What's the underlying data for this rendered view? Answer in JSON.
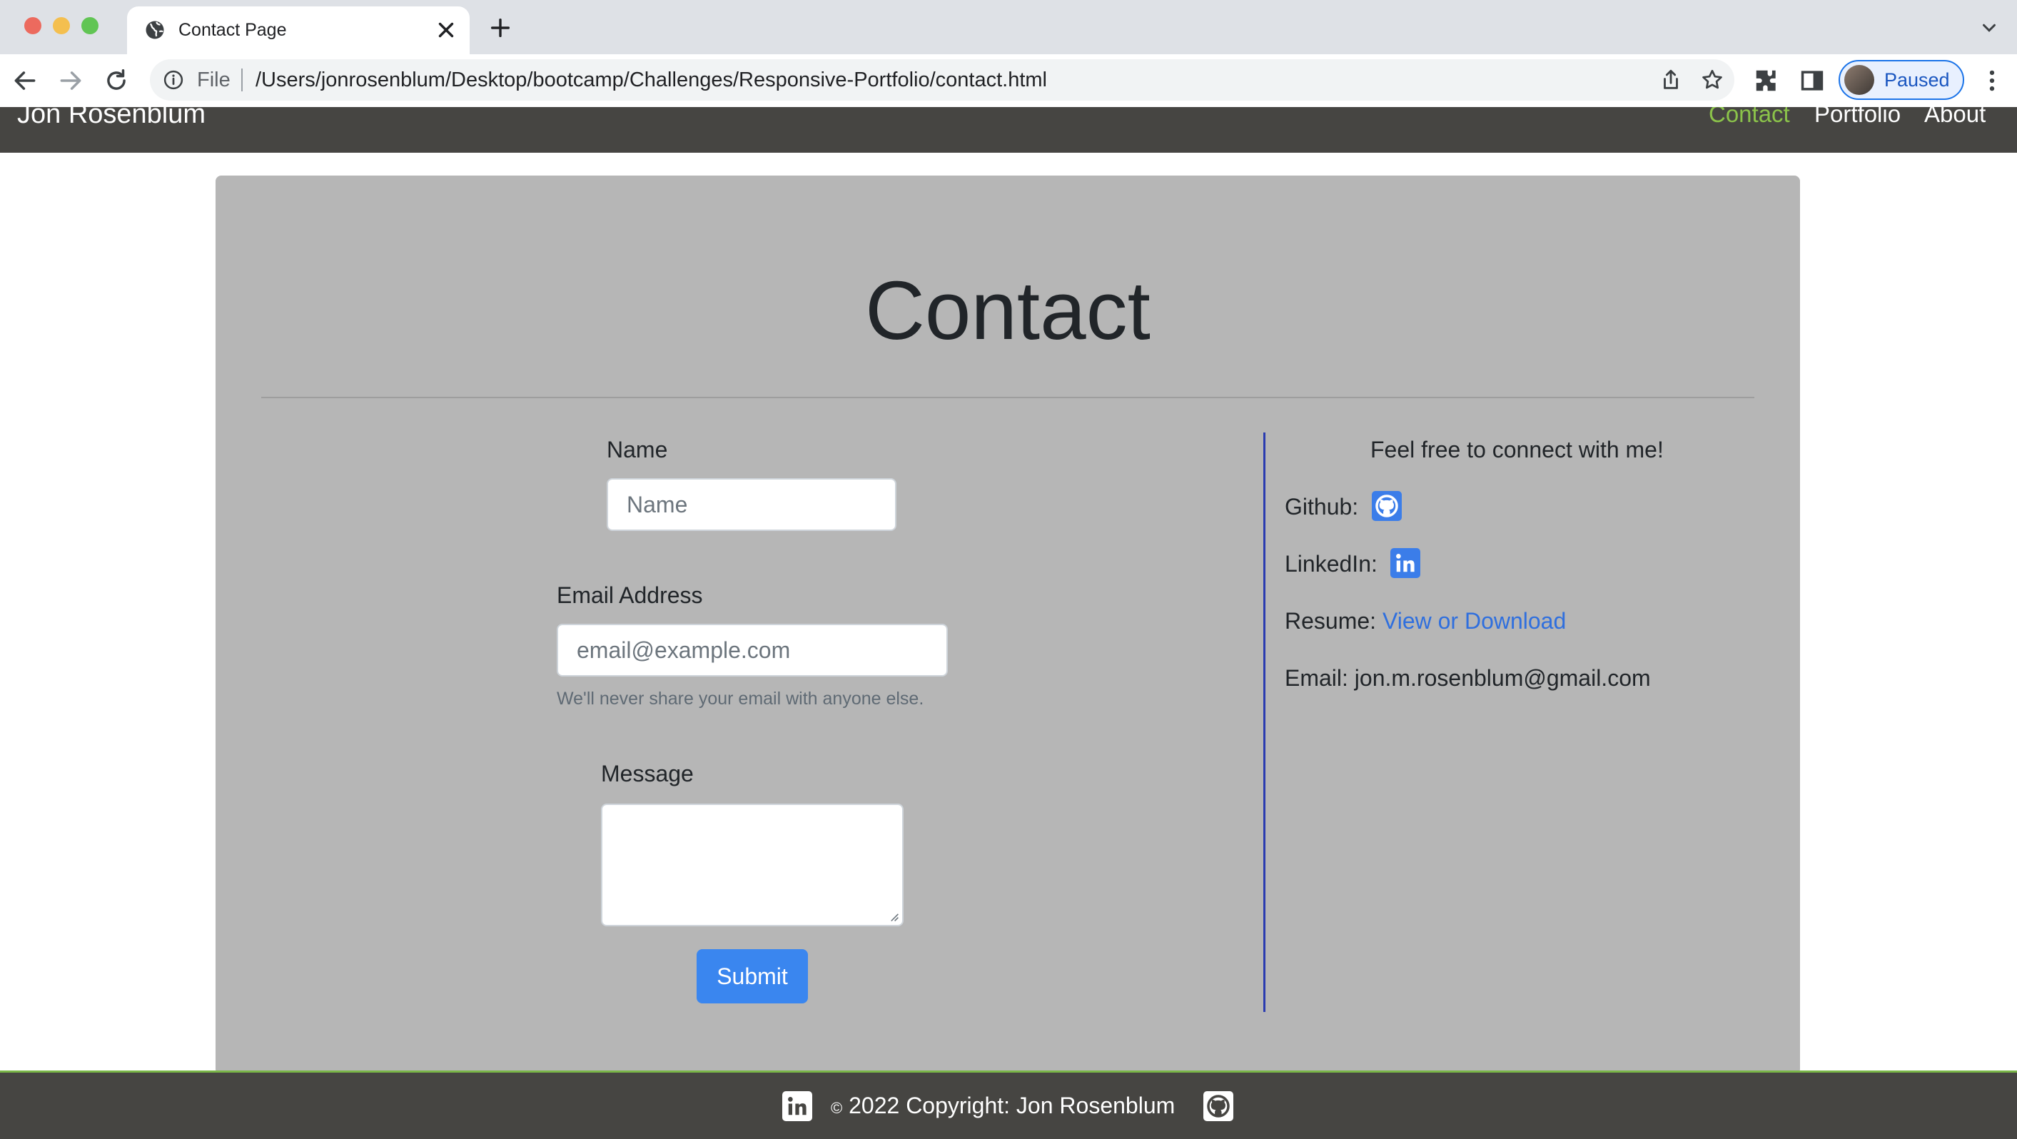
{
  "browser": {
    "tab_title": "Contact Page",
    "url_scheme_label": "File",
    "url": "/Users/jonrosenblum/Desktop/bootcamp/Challenges/Responsive-Portfolio/contact.html",
    "profile_status": "Paused"
  },
  "navbar": {
    "brand": "Jon Rosenblum",
    "links": [
      {
        "label": "Contact",
        "active": true,
        "color": "#8bc34a"
      },
      {
        "label": "Portfolio",
        "active": false
      },
      {
        "label": "About",
        "active": false
      }
    ]
  },
  "main": {
    "heading": "Contact",
    "form": {
      "name_label": "Name",
      "name_placeholder": "Name",
      "email_label": "Email Address",
      "email_placeholder": "email@example.com",
      "email_help": "We'll never share your email with anyone else.",
      "message_label": "Message",
      "submit_label": "Submit"
    },
    "connect": {
      "heading": "Feel free to connect with me!",
      "github_label": "Github:",
      "linkedin_label": "LinkedIn:",
      "resume_label": "Resume:",
      "resume_link": "View or Download",
      "email_label": "Email:",
      "email_value": "jon.m.rosenblum@gmail.com"
    }
  },
  "footer": {
    "copyright_symbol": "©",
    "copyright_text": "2022 Copyright: Jon Rosenblum"
  },
  "colors": {
    "navbar_bg": "#464542",
    "card_bg": "#b6b6b6",
    "accent": "#3a86ef",
    "divider": "#2a3bb0"
  }
}
